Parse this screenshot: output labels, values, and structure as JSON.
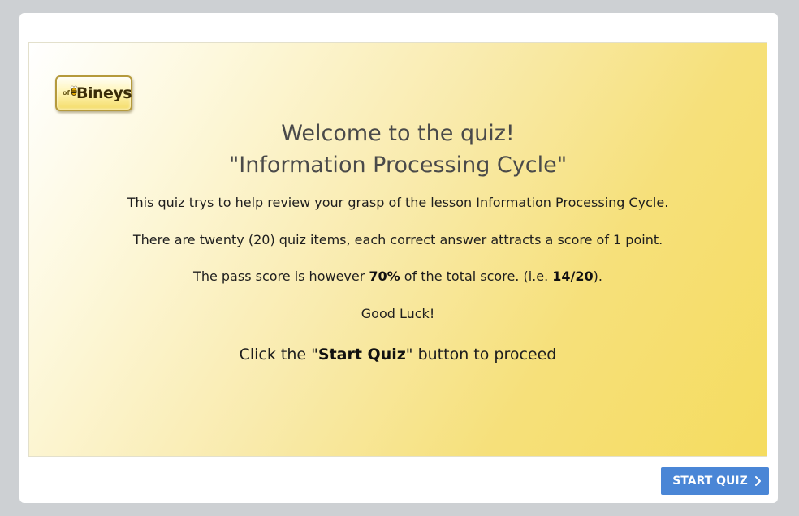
{
  "logo": {
    "prefix": "of",
    "text": "Bineys"
  },
  "slide": {
    "title_line1": "Welcome to the quiz!",
    "title_line2": "\"Information Processing Cycle\"",
    "paragraph1": "This quiz trys to help review your grasp of the lesson Information Processing Cycle.",
    "paragraph2": "There are twenty (20) quiz items, each correct answer attracts a score of 1 point.",
    "paragraph3": {
      "before": "The pass score is however ",
      "bold1": "70%",
      "middle": " of the total score. (i.e. ",
      "bold2": "14/20",
      "after": ")."
    },
    "paragraph4": "Good Luck!",
    "paragraph5": {
      "before": "Click the \"",
      "bold": "Start Quiz",
      "after": "\" button to proceed"
    }
  },
  "footer": {
    "start_button_label": "START QUIZ",
    "start_button_icon": "chevron-right-icon"
  },
  "colors": {
    "button": "#4a86d6",
    "page_background": "#cdd0d3",
    "slide_gradient_end": "#f5dc5f",
    "title_text": "#4a4a4a"
  }
}
